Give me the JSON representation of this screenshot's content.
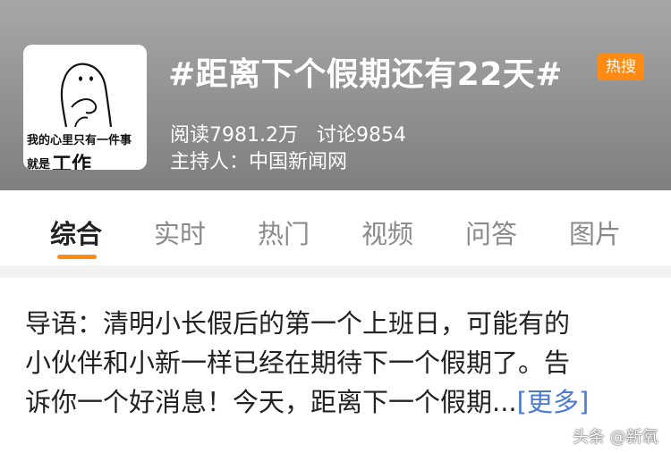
{
  "topic": {
    "thumbnail": {
      "caption_line1": "我的心里只有一件事",
      "caption_line2_prefix": "就是",
      "caption_line2_big": "工作"
    },
    "title": "#距离下个假期还有22天#",
    "badge": "热搜",
    "reads": "阅读7981.2万",
    "discussions": "讨论9854",
    "host": "主持人：中国新闻网"
  },
  "tabs": [
    {
      "label": "综合",
      "active": true
    },
    {
      "label": "实时"
    },
    {
      "label": "热门"
    },
    {
      "label": "视频"
    },
    {
      "label": "问答"
    },
    {
      "label": "图片"
    }
  ],
  "intro": {
    "line1": "导语：清明小长假后的第一个上班日，可能有的",
    "line2": "小伙伴和小新一样已经在期待下一个假期了。告",
    "line3": "诉你一个好消息！今天，距离下一个假期...",
    "more": "[更多]"
  },
  "watermark": "头条 @新氧",
  "colors": {
    "accent": "#ff8a14",
    "link": "#4b7bd1"
  }
}
